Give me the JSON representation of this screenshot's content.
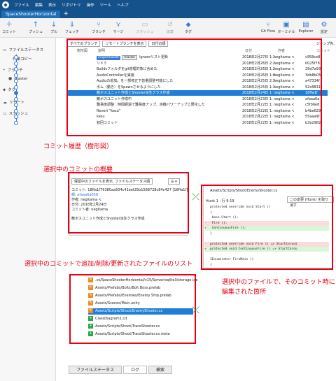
{
  "app": {
    "menu": [
      "ファイル",
      "編集",
      "表示",
      "リポジトリ",
      "操作",
      "ツール",
      "ヘルプ"
    ],
    "tab_title": "SpaceShooterHorizontal",
    "tab_add": "+"
  },
  "toolbar": {
    "commit": "コミット",
    "push": "プッシュ",
    "pull": "プル",
    "fetch": "フェッチ",
    "branch": "ブランチ",
    "merge": "マージ",
    "stash": "スタッシュ",
    "discard": "破棄",
    "tag": "タグ",
    "gitflow": "Git Flow",
    "terminal": "ターミナル",
    "explorer": "Explorer",
    "settings": "設定"
  },
  "sidebar": {
    "file_status": "ファイルステータス",
    "working_copy": "作業コピー",
    "branches": "ブランチ",
    "master": "master",
    "tags": "タグ",
    "remotes": "リモート",
    "stashes": "スタッシュ"
  },
  "filter": {
    "all_branches": "すべてのブランチ",
    "show_remote": "リモートブランチを表示",
    "date_order": "日付の順",
    "search_label": "ジャンプ先:"
  },
  "columns": {
    "graph": "樹形図",
    "description": "説明",
    "date": "日付",
    "author": "作者",
    "commit": "コミット"
  },
  "commits": [
    {
      "badge": "origin/master",
      "badge2": "master",
      "message": "Ignoreリスト更新",
      "date": "2018年2月27日 1:1",
      "author": "negitama <",
      "hash": "c958ce8"
    },
    {
      "message": "リドミ",
      "date": "2018年2月26日 2:2",
      "author": "negitama <",
      "hash": "0025f78"
    },
    {
      "message": "Buildsフォルダをgit管理対象に含めた",
      "date": "2018年2月26日 1:2",
      "author": "negitama <",
      "hash": "29d7a93"
    },
    {
      "message": "AudioControllerを実装",
      "date": "2018年2月26日 1:0",
      "author": "negitama <",
      "hash": "3db8b05"
    },
    {
      "message": "Audioの追加。を一部修正下音量調整可能にした",
      "date": "2018年2月25日 2:3",
      "author": "negitama <",
      "hash": "a47334f"
    },
    {
      "message": "ボム（動き）をSpawnさせるようにした",
      "date": "2018年2月25日 1:1",
      "author": "negitama <",
      "hash": "92c8831"
    },
    {
      "message": "敵ボスユニット作成とShooter派生クラス作成",
      "date": "2018年2月24日 1:",
      "author": "negitama <",
      "hash": "18ffa1f",
      "selected": true
    },
    {
      "message": "敵ボスユニット作成中",
      "date": "2018年2月23日 1:",
      "author": "negitama <",
      "hash": "afaaa6a"
    },
    {
      "message": "難易度調整：時間経過で難易度アップ、自機パワーアップ上限化した",
      "date": "2018年2月22日 1:",
      "author": "negitama <",
      "hash": "c5fb6e8"
    },
    {
      "message": "Revert \"kesu\"",
      "date": "2018年2月22日 1:",
      "author": "negitama <",
      "hash": "b4be629"
    },
    {
      "message": "kesu",
      "date": "2018年2月22日 1:",
      "author": "negitama <",
      "hash": "55aaa9f"
    },
    {
      "message": "初回コミット",
      "date": "2018年2月22日 1:",
      "author": "negitama <",
      "hash": "b3e2982"
    }
  ],
  "annotations": {
    "history": "コミット履歴（樹形図）",
    "summary": "選択中のコミットの概要",
    "files": "選択中のコミットで追加/削除/更新されたファイルのリスト",
    "diff_line1": "選択中のファイルで、そのコミット時に",
    "diff_line2": "編集された箇所"
  },
  "summary": {
    "dropdown": "保留中のファイルを表示, ファイルステータス順",
    "commit_line": "コミット: 18ffa1f79380aa504c41eef25b1588728c84c427 [18ffa1f]",
    "parent_label": "親: afaaa6a658",
    "author_line": "作者: negitama <",
    "date_line": "日付: 2018年2月24日",
    "committer_line": "コミット者: negitama",
    "message": "敵ボスユニット作成とShooter派生クラス作成"
  },
  "files": [
    {
      "status": "mod",
      "path": ".vs/SpaceShooterHorizontal/v15/Server/sqlite3/storage.ide"
    },
    {
      "status": "mod",
      "path": "Assets/Prefabs/Bolts/Bolt Boss.prefab"
    },
    {
      "status": "mod",
      "path": "Assets/Prefabs/Enemies/Enemy Ship.prefab"
    },
    {
      "status": "mod",
      "path": "Assets/Scenes/Main.unity"
    },
    {
      "status": "mod",
      "path": "Assets/Scripts/Shoot/EnemyShooter.cs",
      "selected": true
    },
    {
      "status": "add",
      "path": "ClassDiagram1.cd"
    },
    {
      "status": "add",
      "path": "Assets/Scripts/Shoot/TraceShooter.cs"
    },
    {
      "status": "add",
      "path": "Assets/Scripts/Shoot/TraceShooter.cs.meta"
    }
  ],
  "diff": {
    "file": "Assets/Scripts/Shoot/EnemyShooter.cs",
    "hunk": "Hunk 1 : 行 9-19",
    "change_button": "この変更 (Hunk) を取り消す",
    "lines": [
      {
        "type": "ctx",
        "text": "protected override void Start ()"
      },
      {
        "type": "ctx",
        "text": "{"
      },
      {
        "type": "ctx",
        "text": "    base.Start ();"
      },
      {
        "type": "del",
        "text": "    Fire ();"
      },
      {
        "type": "add",
        "text": "    ContinuousFire ();"
      },
      {
        "type": "ctx",
        "text": "}"
      },
      {
        "type": "ctx",
        "text": ""
      },
      {
        "type": "del",
        "text": "protected override void Fire () => StartCorout"
      },
      {
        "type": "add",
        "text": "protected void ContinuousFire () => StartCorou"
      },
      {
        "type": "ctx",
        "text": ""
      },
      {
        "type": "ctx",
        "text": "IEnumerator FireMain ()"
      },
      {
        "type": "ctx",
        "text": "{"
      }
    ]
  },
  "bottom_tabs": [
    "ファイルステータス",
    "ログ",
    "検索"
  ],
  "colors": {
    "accent": "#1f7ed8",
    "annotation": "#e60012",
    "titlebar": "#15528c"
  }
}
